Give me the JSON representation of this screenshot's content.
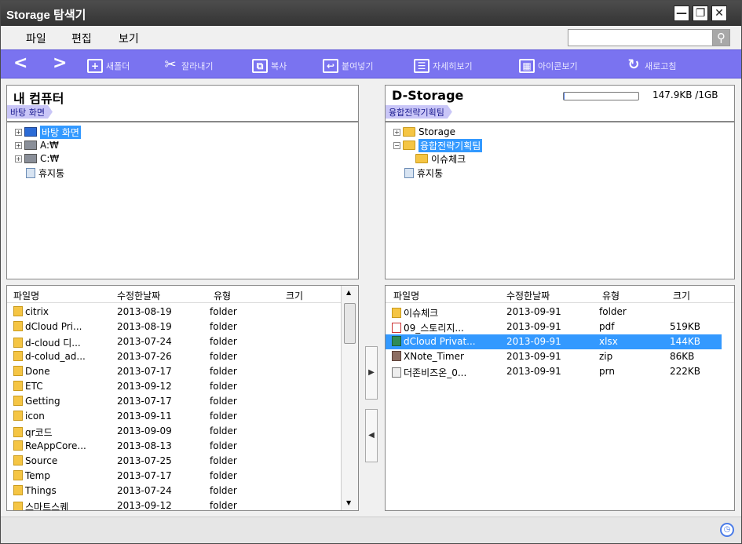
{
  "window": {
    "title": "Storage 탐색기",
    "min": "—",
    "restore": "❐",
    "close": "✕"
  },
  "menu": {
    "file": "파일",
    "edit": "편집",
    "view": "보기"
  },
  "search": {
    "value": "",
    "icon": "🔍"
  },
  "toolbar": {
    "back": "<",
    "forward": ">",
    "new_folder": "새폴더",
    "cut": "잘라내기",
    "copy": "복사",
    "paste": "붙여넣기",
    "detail_view": "자세히보기",
    "icon_view": "아이콘보기",
    "refresh": "새로고침"
  },
  "left": {
    "title": "내 컴퓨터",
    "crumb": "바탕 화면",
    "tree": [
      {
        "label": "바탕 화면",
        "exp": "+",
        "icon": "desktop-icon",
        "selected": true
      },
      {
        "label": "A:₩",
        "exp": "+",
        "icon": "drive-icon"
      },
      {
        "label": "C:₩",
        "exp": "+",
        "icon": "drive-icon"
      },
      {
        "label": "휴지통",
        "exp": "",
        "icon": "recycle-bin-icon"
      }
    ],
    "columns": {
      "name": "파일명",
      "date": "수정한날짜",
      "type": "유형",
      "size": "크기"
    },
    "files": [
      {
        "name": "citrix",
        "date": "2013-08-19",
        "type": "folder",
        "size": ""
      },
      {
        "name": "dCloud Pri...",
        "date": "2013-08-19",
        "type": "folder",
        "size": ""
      },
      {
        "name": "d-cloud 디...",
        "date": "2013-07-24",
        "type": "folder",
        "size": ""
      },
      {
        "name": "d-colud_ad...",
        "date": "2013-07-26",
        "type": "folder",
        "size": ""
      },
      {
        "name": "Done",
        "date": "2013-07-17",
        "type": "folder",
        "size": ""
      },
      {
        "name": "ETC",
        "date": "2013-09-12",
        "type": "folder",
        "size": ""
      },
      {
        "name": "Getting",
        "date": "2013-07-17",
        "type": "folder",
        "size": ""
      },
      {
        "name": "icon",
        "date": "2013-09-11",
        "type": "folder",
        "size": ""
      },
      {
        "name": "qr코드",
        "date": "2013-09-09",
        "type": "folder",
        "size": ""
      },
      {
        "name": "ReAppCore...",
        "date": "2013-08-13",
        "type": "folder",
        "size": ""
      },
      {
        "name": "Source",
        "date": "2013-07-25",
        "type": "folder",
        "size": ""
      },
      {
        "name": "Temp",
        "date": "2013-07-17",
        "type": "folder",
        "size": ""
      },
      {
        "name": "Things",
        "date": "2013-07-24",
        "type": "folder",
        "size": ""
      },
      {
        "name": "스마트스퀘",
        "date": "2013-09-12",
        "type": "folder",
        "size": ""
      }
    ]
  },
  "right": {
    "title": "D-Storage",
    "usage": "147.9KB /1GB",
    "usage_fraction": 0.0001,
    "crumb": "융합전략기획팀",
    "tree": [
      {
        "label": "Storage",
        "exp": "+",
        "icon": "folder-icon",
        "indent": 0
      },
      {
        "label": "융합전략기획팀",
        "exp": "−",
        "icon": "folder-icon",
        "indent": 0,
        "selected": true
      },
      {
        "label": "이슈체크",
        "exp": "",
        "icon": "folder-icon",
        "indent": 1
      },
      {
        "label": "휴지통",
        "exp": "",
        "icon": "recycle-bin-icon",
        "indent": 0
      }
    ],
    "columns": {
      "name": "파일명",
      "date": "수정한날짜",
      "type": "유형",
      "size": "크기"
    },
    "files": [
      {
        "name": "이슈체크",
        "date": "2013-09-91",
        "type": "folder",
        "size": "",
        "icon": "folder-icon"
      },
      {
        "name": "09_스토리지...",
        "date": "2013-09-91",
        "type": "pdf",
        "size": "519KB",
        "icon": "pdf-icon"
      },
      {
        "name": "dCloud Privat...",
        "date": "2013-09-91",
        "type": "xlsx",
        "size": "144KB",
        "icon": "excel-icon",
        "selected": true
      },
      {
        "name": "XNote_Timer",
        "date": "2013-09-91",
        "type": "zip",
        "size": "86KB",
        "icon": "zip-icon"
      },
      {
        "name": "더존비즈온_0...",
        "date": "2013-09-91",
        "type": "prn",
        "size": "222KB",
        "icon": "file-icon"
      }
    ]
  },
  "transfer": {
    "to_right": "▶",
    "to_left": "◀"
  }
}
